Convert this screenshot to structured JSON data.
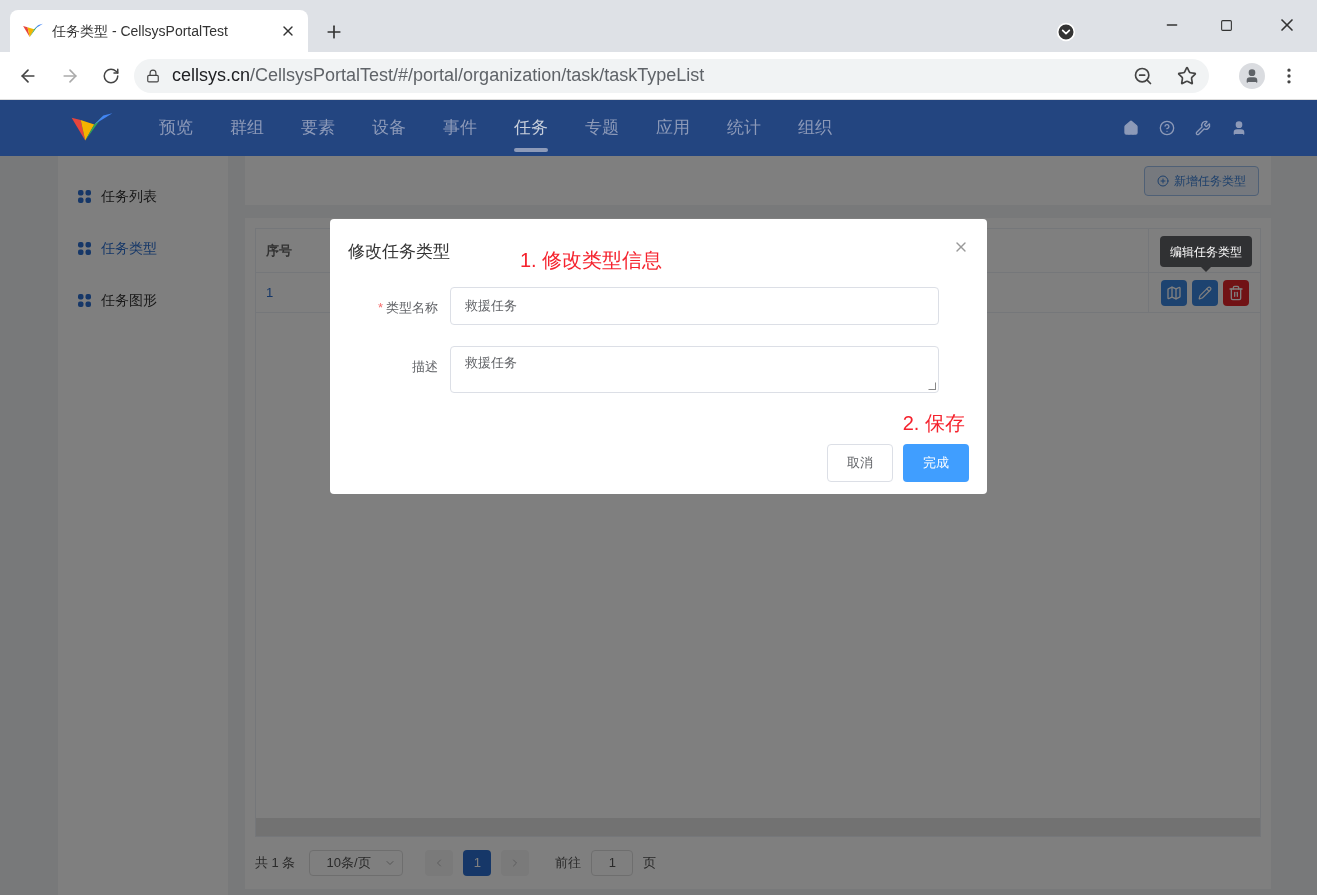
{
  "browser": {
    "tab_title": "任务类型 - CellsysPortalTest",
    "url_host": "cellsys.cn",
    "url_path": "/CellsysPortalTest/#/portal/organization/task/taskTypeList"
  },
  "nav": [
    {
      "label": "预览",
      "selected": false
    },
    {
      "label": "群组",
      "selected": false
    },
    {
      "label": "要素",
      "selected": false
    },
    {
      "label": "设备",
      "selected": false
    },
    {
      "label": "事件",
      "selected": false
    },
    {
      "label": "任务",
      "selected": true
    },
    {
      "label": "专题",
      "selected": false
    },
    {
      "label": "应用",
      "selected": false
    },
    {
      "label": "统计",
      "selected": false
    },
    {
      "label": "组织",
      "selected": false
    }
  ],
  "sidebar": [
    {
      "label": "任务列表",
      "selected": false
    },
    {
      "label": "任务类型",
      "selected": true
    },
    {
      "label": "任务图形",
      "selected": false
    }
  ],
  "add_button": "新增任务类型",
  "table": {
    "columns": [
      "序号"
    ],
    "rows": [
      [
        "1"
      ]
    ],
    "tooltip": "编辑任务类型"
  },
  "pagination": {
    "total": "共 1 条",
    "page_size": "10条/页",
    "pages": [
      {
        "label": "1",
        "selected": true
      }
    ],
    "goto_label": "前往",
    "goto_value": "1",
    "goto_suffix": "页"
  },
  "dialog": {
    "title": "修改任务类型",
    "required_mark": "*",
    "fields": [
      {
        "kind": "input",
        "label": "类型名称",
        "required": true,
        "value": "救援任务"
      },
      {
        "kind": "textarea",
        "label": "描述",
        "required": false,
        "value": "救援任务"
      }
    ],
    "buttons": [
      {
        "kind": "secondary",
        "label": "取消"
      },
      {
        "kind": "primary",
        "label": "完成"
      }
    ],
    "annotations": [
      "1. 修改类型信息",
      "2. 保存"
    ]
  }
}
